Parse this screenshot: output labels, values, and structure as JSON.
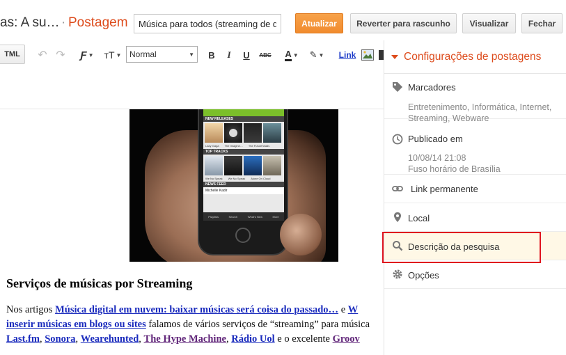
{
  "header": {
    "blog_name": "as: A su…",
    "separator": "·",
    "section": "Postagem",
    "title_value": "Música para todos (streaming de q",
    "buttons": {
      "update": "Atualizar",
      "revert": "Reverter para rascunho",
      "preview": "Visualizar",
      "close": "Fechar"
    }
  },
  "toolbar": {
    "html": "TML",
    "undo": "↶",
    "redo": "↷",
    "font": "Ƒ",
    "font_size": "тT",
    "format_value": "Normal",
    "bold": "B",
    "italic": "I",
    "underline": "U",
    "strike": "ABC",
    "text_color": "A",
    "highlight": "✎",
    "link": "Link"
  },
  "phone_screen": {
    "new_releases": "NEW RELEASES",
    "top_tracks": "TOP TRACKS",
    "news_feed": "NEWS FEED",
    "album_caption_1": "Lady Gaga",
    "album_caption_2": "The Imagine…",
    "album_caption_3": "The Futureheads",
    "track_caption_1": "We No Speak",
    "track_caption_2": "We No Speak",
    "track_caption_3": "Alone On Cloud",
    "news_user": "Michelle Kadir",
    "tabs": [
      "Playlists",
      "Search",
      "What's New",
      "More"
    ]
  },
  "post": {
    "heading": "Serviços de músicas por Streaming",
    "line1_pre": "Nos artigos ",
    "line1_link": "Música digital em nuvem: baixar músicas será coisa do passado…",
    "line1_mid": " e ",
    "line1_link2": "W",
    "line2_link": "inserir músicas em blogs ou sites",
    "line2_text": " falamos de vários serviços de “streaming” para música",
    "line3_link1": "Last.fm",
    "line3_sep1": ", ",
    "line3_link2": "Sonora",
    "line3_sep2": ", ",
    "line3_link3": "Wearehunted",
    "line3_sep3": ", ",
    "line3_link4": "The Hype Machine",
    "line3_sep4": ", ",
    "line3_link5": "Rádio Uol",
    "line3_text": " e o excelente ",
    "line3_link6": "Groov"
  },
  "sidebar": {
    "title": "Configurações de postagens",
    "labels": {
      "title": "Marcadores",
      "value_line1": "Entretenimento, Informática, Internet,",
      "value_line2": "Streaming, Webware"
    },
    "published": {
      "title": "Publicado em",
      "date": "10/08/14 21:08",
      "timezone": "Fuso horário de Brasília"
    },
    "permalink": "Link permanente",
    "location": "Local",
    "search_description": "Descrição da pesquisa",
    "options": "Opções"
  },
  "colors": {
    "accent": "#dd4b1c",
    "primary_button": "#f18b2e",
    "link": "#1a2bbd",
    "visited_link": "#61267a",
    "highlight_box": "#e0141e"
  }
}
